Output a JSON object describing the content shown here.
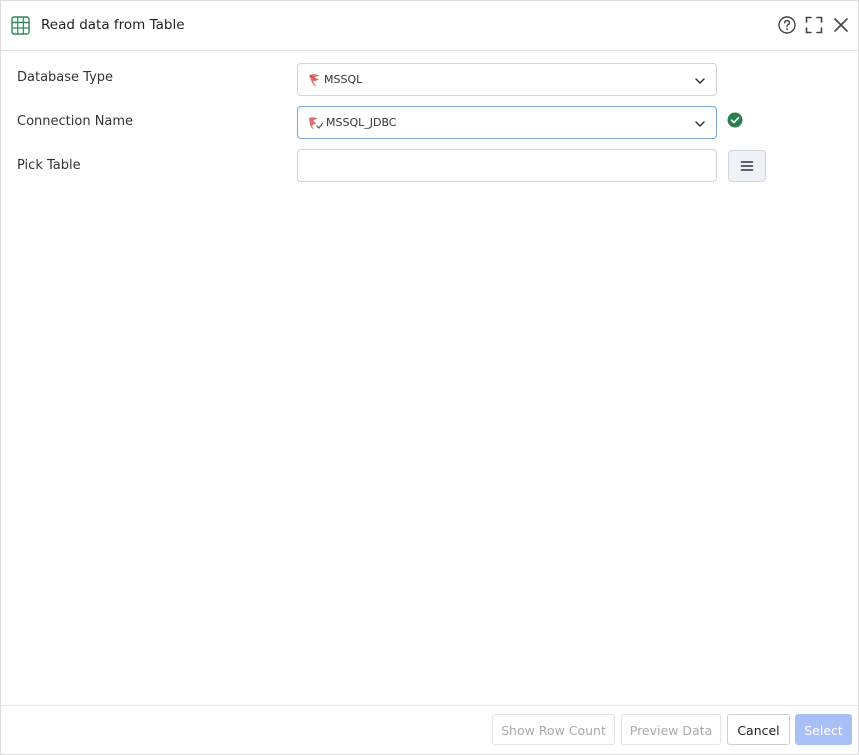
{
  "dialog": {
    "title": "Read data from Table"
  },
  "form": {
    "database_type": {
      "label": "Database Type",
      "value": "MSSQL"
    },
    "connection_name": {
      "label": "Connection Name",
      "value": "MSSQL_JDBC"
    },
    "pick_table": {
      "label": "Pick Table",
      "value": "",
      "placeholder": ""
    }
  },
  "footer": {
    "show_row_count": "Show Row Count",
    "preview_data": "Preview Data",
    "cancel": "Cancel",
    "select": "Select"
  },
  "colors": {
    "table_icon": "#2e8b57",
    "status_ok": "#2e7d4f",
    "primary_disabled": "#a9bff7",
    "focus_border": "#7aa7d6"
  },
  "icons": {
    "header": [
      "table-icon",
      "help-icon",
      "maximize-icon",
      "close-icon"
    ],
    "form": [
      "mssql-icon",
      "mssql-connection-icon",
      "chevron-down-icon",
      "check-circle-icon",
      "list-icon"
    ]
  }
}
